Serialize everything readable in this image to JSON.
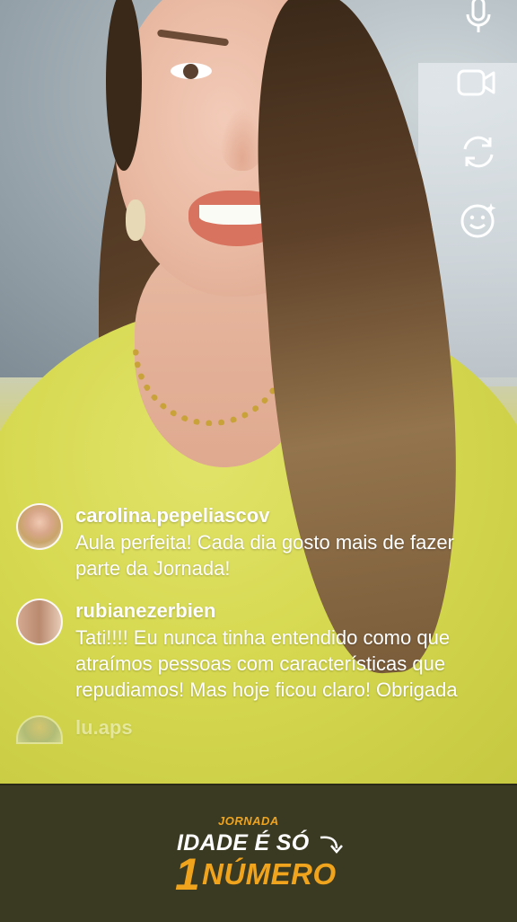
{
  "live": {
    "controls": [
      {
        "icon": "microphone-icon"
      },
      {
        "icon": "video-camera-icon"
      },
      {
        "icon": "flip-camera-icon"
      },
      {
        "icon": "effects-smiley-icon"
      }
    ]
  },
  "comments": [
    {
      "username": "carolina.pepeliascov",
      "text": "Aula perfeita! Cada dia gosto mais de fazer parte da Jornada!"
    },
    {
      "username": "rubianezerbien",
      "text": "Tati!!!! Eu nunca tinha entendido como  que atraímos pessoas com características que repudiamos! Mas hoje ficou claro! Obrigada"
    },
    {
      "username": "lu.aps",
      "text": ""
    }
  ],
  "banner": {
    "logo_small": "JORNADA",
    "logo_line1": "IDADE É SÓ",
    "logo_number": "1",
    "logo_line2": "NÚMERO"
  },
  "colors": {
    "banner_bg": "#3a3922",
    "logo_orange": "#f0a41e",
    "shirt_yellow": "#d5d84e"
  }
}
